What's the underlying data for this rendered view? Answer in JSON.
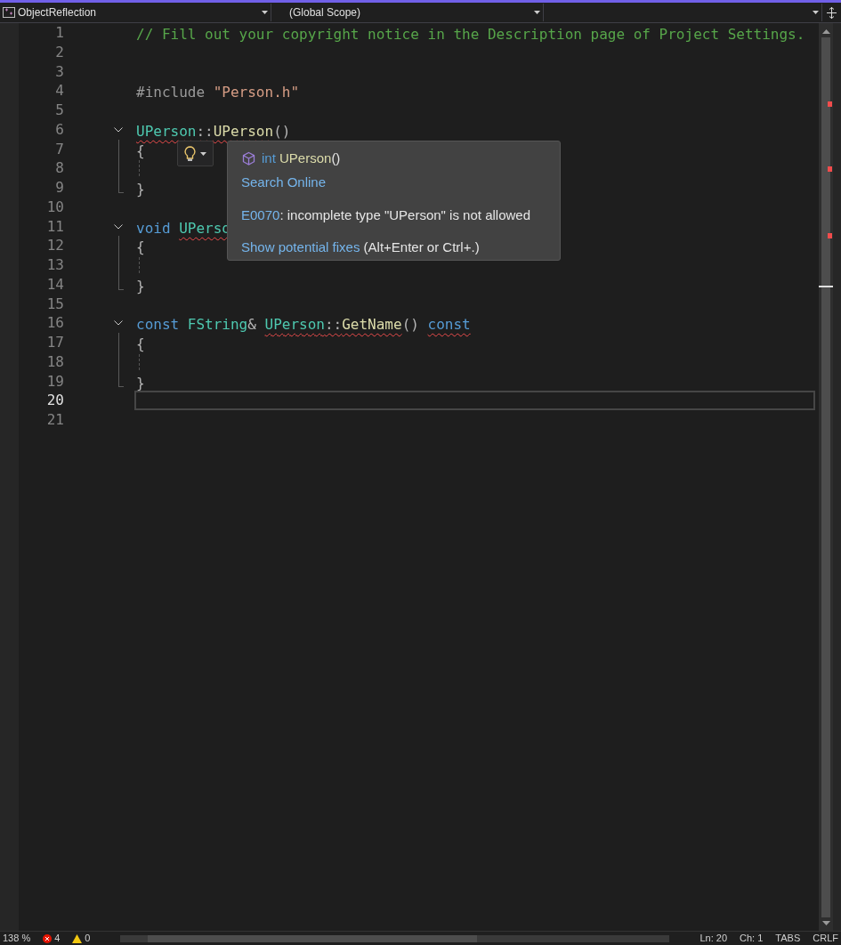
{
  "navigation_bar": {
    "project": "ObjectReflection",
    "scope": "(Global Scope)"
  },
  "editor": {
    "lines": [
      {
        "number": "1",
        "current": false,
        "kind": "plain",
        "tokens": [
          {
            "text": "// Fill out your copyright notice in the Description page of Project Settings.",
            "kind": "comment",
            "squiggle": false
          }
        ]
      },
      {
        "number": "2",
        "current": false,
        "kind": "plain"
      },
      {
        "number": "3",
        "current": false,
        "kind": "plain"
      },
      {
        "number": "4",
        "current": false,
        "kind": "plain",
        "tokens": [
          {
            "text": "#include ",
            "kind": "preproc",
            "squiggle": false
          },
          {
            "text": "\"Person.h\"",
            "kind": "string",
            "squiggle": false
          }
        ]
      },
      {
        "number": "5",
        "current": false,
        "kind": "plain"
      },
      {
        "number": "6",
        "current": false,
        "kind": "fold_start",
        "tokens": [
          {
            "text": "UPerson",
            "kind": "type",
            "squiggle": true
          },
          {
            "text": "::",
            "kind": "punct",
            "squiggle": true
          },
          {
            "text": "UPerson",
            "kind": "func",
            "squiggle": true
          },
          {
            "text": "()",
            "kind": "punct",
            "squiggle": false
          }
        ]
      },
      {
        "number": "7",
        "current": false,
        "kind": "fold_body",
        "tokens": [
          {
            "text": "{",
            "kind": "punct",
            "squiggle": false
          }
        ]
      },
      {
        "number": "8",
        "current": false,
        "kind": "fold_body"
      },
      {
        "number": "9",
        "current": false,
        "kind": "fold_end",
        "tokens": [
          {
            "text": "}",
            "kind": "punct",
            "squiggle": false
          }
        ]
      },
      {
        "number": "10",
        "current": false,
        "kind": "plain"
      },
      {
        "number": "11",
        "current": false,
        "kind": "fold_start",
        "tokens": [
          {
            "text": "void ",
            "kind": "keyword",
            "squiggle": false
          },
          {
            "text": "UPerso",
            "kind": "type",
            "squiggle": true
          }
        ]
      },
      {
        "number": "12",
        "current": false,
        "kind": "fold_body",
        "tokens": [
          {
            "text": "{",
            "kind": "punct",
            "squiggle": false
          }
        ]
      },
      {
        "number": "13",
        "current": false,
        "kind": "fold_body"
      },
      {
        "number": "14",
        "current": false,
        "kind": "fold_end",
        "tokens": [
          {
            "text": "}",
            "kind": "punct",
            "squiggle": false
          }
        ]
      },
      {
        "number": "15",
        "current": false,
        "kind": "plain"
      },
      {
        "number": "16",
        "current": false,
        "kind": "fold_start",
        "tokens": [
          {
            "text": "const ",
            "kind": "keyword",
            "squiggle": false
          },
          {
            "text": "FString",
            "kind": "type",
            "squiggle": false
          },
          {
            "text": "& ",
            "kind": "punct",
            "squiggle": false
          },
          {
            "text": "UPerson",
            "kind": "type",
            "squiggle": true
          },
          {
            "text": "::",
            "kind": "punct",
            "squiggle": true
          },
          {
            "text": "GetName",
            "kind": "func",
            "squiggle": true
          },
          {
            "text": "() ",
            "kind": "punct",
            "squiggle": false
          },
          {
            "text": "const",
            "kind": "keyword",
            "squiggle": true
          }
        ]
      },
      {
        "number": "17",
        "current": false,
        "kind": "fold_body",
        "tokens": [
          {
            "text": "{",
            "kind": "punct",
            "squiggle": false
          }
        ]
      },
      {
        "number": "18",
        "current": false,
        "kind": "fold_body"
      },
      {
        "number": "19",
        "current": false,
        "kind": "fold_end",
        "tokens": [
          {
            "text": "}",
            "kind": "punct",
            "squiggle": false
          }
        ]
      },
      {
        "number": "20",
        "current": true,
        "kind": "plain"
      },
      {
        "number": "21",
        "current": false,
        "kind": "plain"
      }
    ]
  },
  "quick_info": {
    "signature": [
      {
        "text": "int",
        "kind": "keyword"
      },
      {
        "text": " UPerson",
        "kind": "func"
      },
      {
        "text": "()",
        "kind": "plain"
      }
    ],
    "search_link": "Search Online",
    "error_code": "E0070",
    "error_message": ": incomplete type \"UPerson\" is not allowed",
    "fix_link": "Show potential fixes",
    "fix_shortcut": " (Alt+Enter or Ctrl+.)"
  },
  "status_bar": {
    "zoom": "138 %",
    "errors": "4",
    "warnings": "0",
    "line": "Ln: 20",
    "column": "Ch: 1",
    "indent": "TABS",
    "line_endings": "CRLF"
  }
}
